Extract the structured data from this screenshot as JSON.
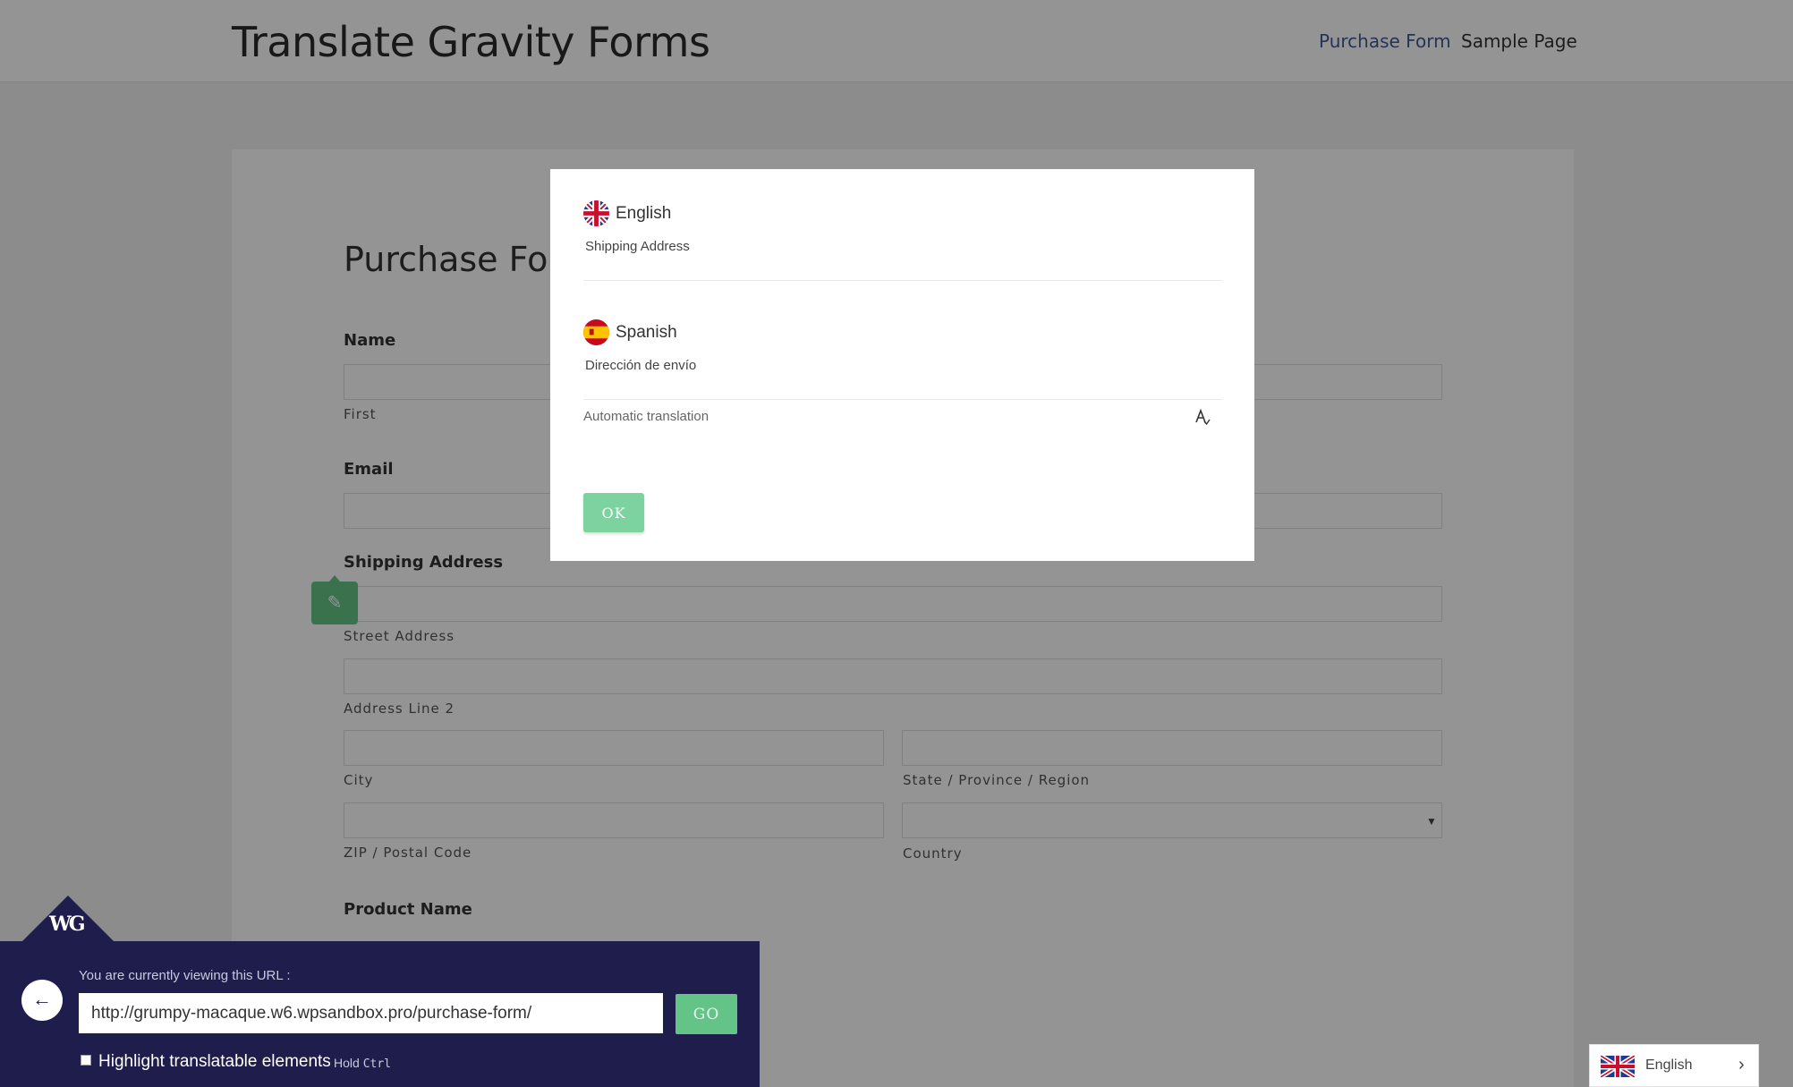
{
  "site": {
    "title": "Translate Gravity Forms",
    "nav": [
      "Purchase Form",
      "Sample Page"
    ]
  },
  "form": {
    "title": "Purchase Form",
    "name_label": "Name",
    "first_label": "First",
    "email_label": "Email",
    "shipping_label": "Shipping Address",
    "street_label": "Street Address",
    "line2_label": "Address Line 2",
    "city_label": "City",
    "state_label": "State / Province / Region",
    "zip_label": "ZIP / Postal Code",
    "country_label": "Country",
    "product_label": "Product Name"
  },
  "modal": {
    "source_language": "English",
    "source_text": "Shipping Address",
    "target_language": "Spanish",
    "target_text": "Dirección de envío",
    "auto_translation_label": "Automatic translation",
    "ok_label": "OK"
  },
  "toolbar": {
    "logo": "WG",
    "url_caption": "You are currently viewing this URL :",
    "url_value": "http://grumpy-macaque.w6.wpsandbox.pro/purchase-form/",
    "go_label": "GO",
    "highlight_label": "Highlight translatable elements",
    "hold_prefix": "Hold",
    "hold_key": "Ctrl"
  },
  "language_switcher": {
    "current": "English"
  },
  "icons": {
    "back": "arrow-left-icon",
    "edit": "pencil-icon",
    "translate": "translate-icon",
    "chevron": "chevron-right-icon"
  },
  "colors": {
    "accent_green": "#64c487",
    "toolbar_bg": "#1e1d4c",
    "nav_active": "#3f5b96"
  }
}
